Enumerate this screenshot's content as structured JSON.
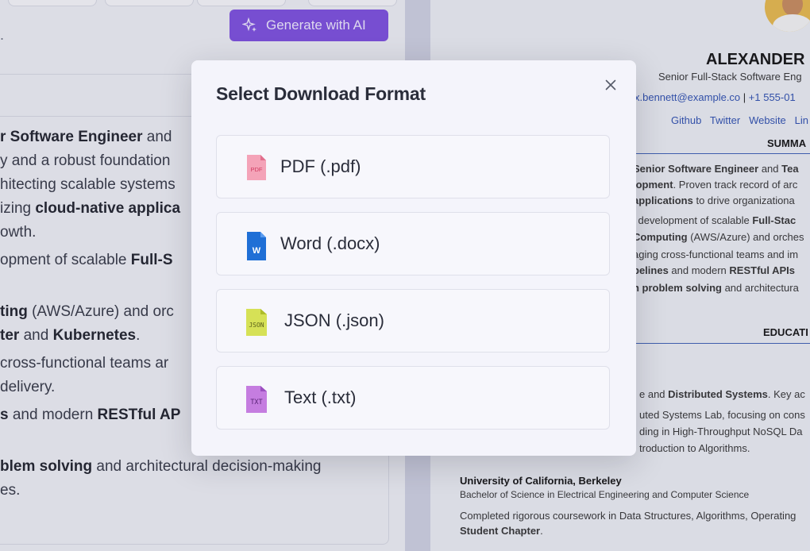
{
  "editor": {
    "generate_button": "Generate with AI",
    "header_fragment": ".",
    "lines": [
      {
        "parts": [
          {
            "t": "r Software Engineer",
            "b": true
          },
          {
            "t": " and ",
            "b": false
          }
        ]
      },
      {
        "parts": [
          {
            "t": "y and a robust foundation",
            "b": false
          }
        ]
      },
      {
        "parts": [
          {
            "t": "hitecting scalable systems",
            "b": false
          }
        ]
      },
      {
        "parts": [
          {
            "t": "izing ",
            "b": false
          },
          {
            "t": "cloud-native applica",
            "b": true
          }
        ]
      },
      {
        "parts": [
          {
            "t": "owth.",
            "b": false
          }
        ]
      },
      {
        "parts": [
          {
            "t": "opment of scalable ",
            "b": false
          },
          {
            "t": "Full-S",
            "b": true
          }
        ]
      },
      {
        "parts": [
          {
            "t": "ting",
            "b": true
          },
          {
            "t": " (AWS/Azure) and orc",
            "b": false
          }
        ]
      },
      {
        "parts": [
          {
            "t": "ter",
            "b": true
          },
          {
            "t": " and ",
            "b": false
          },
          {
            "t": "Kubernetes",
            "b": true
          },
          {
            "t": ".",
            "b": false
          }
        ]
      },
      {
        "parts": [
          {
            "t": " cross-functional teams ar",
            "b": false
          }
        ]
      },
      {
        "parts": [
          {
            "t": "delivery.",
            "b": false
          }
        ]
      },
      {
        "parts": [
          {
            "t": "s",
            "b": true
          },
          {
            "t": " and modern ",
            "b": false
          },
          {
            "t": "RESTful AP",
            "b": true
          }
        ]
      },
      {
        "parts": [
          {
            "t": "blem solving",
            "b": true
          },
          {
            "t": " and architectural decision-making",
            "b": false
          }
        ]
      },
      {
        "parts": [
          {
            "t": "es.",
            "b": false
          }
        ]
      }
    ]
  },
  "resume": {
    "name": "ALEXANDER",
    "role": "Senior Full-Stack Software Eng",
    "contact_email": "x.bennett@example.co",
    "contact_sep": " | ",
    "contact_phone": "+1 555-01",
    "links": [
      "Github",
      "Twitter",
      "Website",
      "Lin"
    ],
    "summary_title": "SUMMA",
    "summary_lines": [
      [
        {
          "t": "Senior Software Engineer",
          "b": true
        },
        {
          "t": " and ",
          "b": false
        },
        {
          "t": "Tea",
          "b": true
        }
      ],
      [
        {
          "t": "lopment",
          "b": true
        },
        {
          "t": ". Proven track record of arc",
          "b": false
        }
      ],
      [
        {
          "t": " applications",
          "b": true
        },
        {
          "t": " to drive organizationa",
          "b": false
        }
      ],
      [
        {
          "t": "l development of scalable ",
          "b": false
        },
        {
          "t": "Full-Stac",
          "b": true
        }
      ],
      [
        {
          "t": "Computing",
          "b": true
        },
        {
          "t": " (AWS/Azure) and orches",
          "b": false
        }
      ],
      [
        {
          "t": "aging cross-functional teams and im",
          "b": false
        }
      ],
      [
        {
          "t": "pelines",
          "b": true
        },
        {
          "t": " and modern ",
          "b": false
        },
        {
          "t": "RESTful APIs",
          "b": true
        }
      ],
      [
        {
          "t": "n problem solving",
          "b": true
        },
        {
          "t": " and architectura",
          "b": false
        }
      ]
    ],
    "education_title": "EDUCATI",
    "edu_lines": [
      [
        {
          "t": "e and ",
          "b": false
        },
        {
          "t": "Distributed Systems",
          "b": true
        },
        {
          "t": ". Key ac",
          "b": false
        }
      ],
      [
        {
          "t": "uted Systems Lab, focusing on cons",
          "b": false
        }
      ],
      [
        {
          "t": "ding in High-Throughput NoSQL Da",
          "b": false
        }
      ],
      [
        {
          "t": "troduction to Algorithms.",
          "b": false
        }
      ]
    ],
    "school": "University of California, Berkeley",
    "degree": "Bachelor of Science in Electrical Engineering and Computer Science",
    "coursework_lines": [
      [
        {
          "t": "Completed rigorous coursework in Data Structures, Algorithms, Operating",
          "b": false
        }
      ],
      [
        {
          "t": "Student Chapter",
          "b": true
        },
        {
          "t": ".",
          "b": false
        }
      ]
    ]
  },
  "modal": {
    "title": "Select Download Format",
    "close_icon": "close-icon",
    "options": [
      {
        "label": "PDF (.pdf)",
        "icon": "pdf-file-icon",
        "icon_text": "PDF",
        "color": "#f4a3b8",
        "fold": "#e26f8d",
        "text_color": "#d03c62"
      },
      {
        "label": "Word (.docx)",
        "icon": "word-file-icon",
        "icon_text": "W",
        "color": "#1f6fd6",
        "fold": "#5a9bef",
        "text_color": "#ffffff"
      },
      {
        "label": "JSON (.json)",
        "icon": "json-file-icon",
        "icon_text": "JSON",
        "color": "#d6e156",
        "fold": "#aebd2a",
        "text_color": "#5b611a"
      },
      {
        "label": "Text (.txt)",
        "icon": "txt-file-icon",
        "icon_text": "TXT",
        "color": "#c57de0",
        "fold": "#9b4fc0",
        "text_color": "#5a2477"
      }
    ]
  }
}
